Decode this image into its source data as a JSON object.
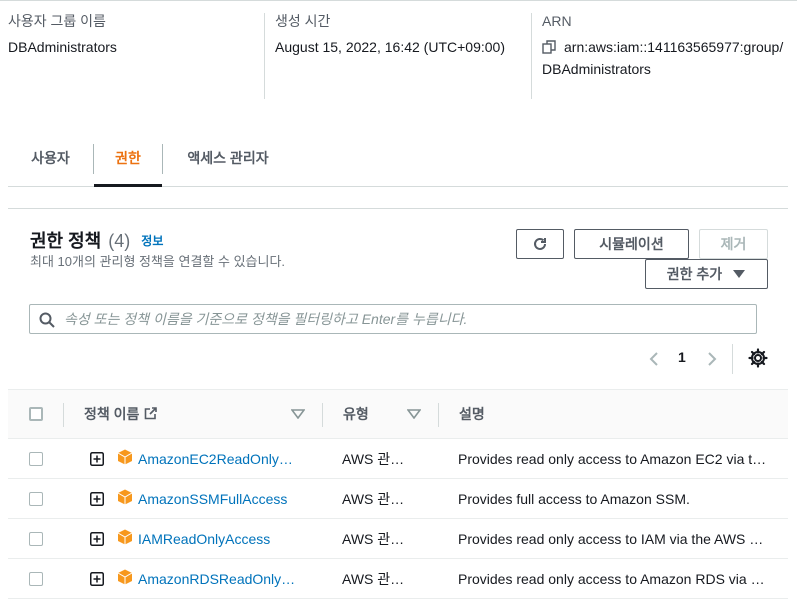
{
  "summary": {
    "group_name_label": "사용자 그룹 이름",
    "group_name_value": "DBAdministrators",
    "created_label": "생성 시간",
    "created_value": "August 15, 2022, 16:42 (UTC+09:00)",
    "arn_label": "ARN",
    "arn_value_line1": "arn:aws:iam::141163565977:group/",
    "arn_value_line2": "DBAdministrators"
  },
  "tabs": [
    {
      "label": "사용자",
      "active": false
    },
    {
      "label": "권한",
      "active": true
    },
    {
      "label": "액세스 관리자",
      "active": false
    }
  ],
  "panel": {
    "title": "권한 정책",
    "count": "(4)",
    "info_link": "정보",
    "description": "최대 10개의 관리형 정책을 연결할 수 있습니다.",
    "refresh_icon": "refresh-icon",
    "simulate_button": "시뮬레이션",
    "remove_button": "제거",
    "add_permissions_button": "권한 추가",
    "search_placeholder": "속성 또는 정책 이름을 기준으로 정책을 필터링하고 Enter를 누릅니다.",
    "search_value": "",
    "current_page": "1"
  },
  "table": {
    "headers": {
      "policy_name": "정책 이름",
      "type": "유형",
      "description": "설명"
    },
    "rows": [
      {
        "name": "AmazonEC2ReadOnly…",
        "type": "AWS 관…",
        "description": "Provides read only access to Amazon EC2 via t…"
      },
      {
        "name": "AmazonSSMFullAccess",
        "type": "AWS 관…",
        "description": "Provides full access to Amazon SSM."
      },
      {
        "name": "IAMReadOnlyAccess",
        "type": "AWS 관…",
        "description": "Provides read only access to IAM via the AWS …"
      },
      {
        "name": "AmazonRDSReadOnly…",
        "type": "AWS 관…",
        "description": "Provides read only access to Amazon RDS via …"
      }
    ]
  },
  "colors": {
    "active_tab": "#ec7211",
    "link": "#0073bb",
    "policy_icon": "#f7981d"
  }
}
